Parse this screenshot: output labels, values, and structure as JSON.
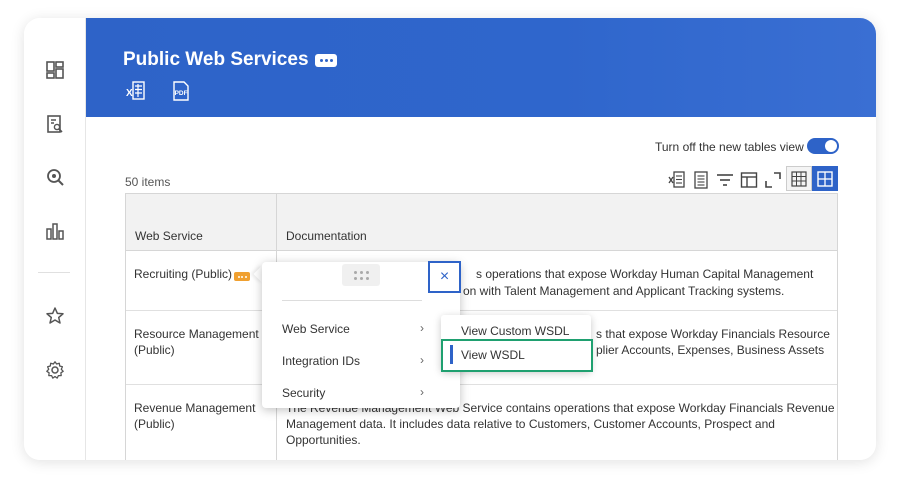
{
  "header": {
    "title": "Public Web Services",
    "export_excel_label": "X",
    "export_pdf_label": "PDF"
  },
  "content": {
    "toggle_label": "Turn off the new tables view",
    "toggle_on": true,
    "items_count": "50 items"
  },
  "table": {
    "columns": [
      "Web Service",
      "Documentation"
    ],
    "rows": [
      {
        "service": "Recruiting (Public)",
        "doc_line1": "s operations that expose Workday Human Capital Management",
        "doc_line2": "on with Talent Management and Applicant Tracking systems."
      },
      {
        "service_line1": "Resource Management",
        "service_line2": "(Public)",
        "doc_line1": "s that expose Workday Financials Resource",
        "doc_line2": "plier Accounts, Expenses, Business Assets"
      },
      {
        "service_line1": "Revenue Management",
        "service_line2": "(Public)",
        "doc_line1": "The Revenue Management  Web Service contains operations that expose Workday Financials Revenue",
        "doc_line2": "Management data. It includes data relative to Customers, Customer Accounts, Prospect and",
        "doc_line3": "Opportunities."
      }
    ]
  },
  "popup": {
    "items": [
      "Web Service",
      "Integration IDs",
      "Security"
    ],
    "close_label": "×",
    "chevron": "›"
  },
  "submenu": {
    "items": [
      "View Custom WSDL",
      "View WSDL"
    ],
    "active_index": 1
  },
  "colors": {
    "brand": "#2e63c8",
    "badge": "#f0a030",
    "highlight": "#1fa070"
  },
  "icons": {
    "sidebar": [
      "dashboard-icon",
      "report-search-icon",
      "search-icon",
      "chart-icon",
      "star-icon",
      "gear-icon"
    ],
    "toolbar": [
      "export-excel-icon",
      "print-icon",
      "filter-icon",
      "columns-icon",
      "fullscreen-icon",
      "table-view-icon",
      "grid-view-icon"
    ]
  }
}
